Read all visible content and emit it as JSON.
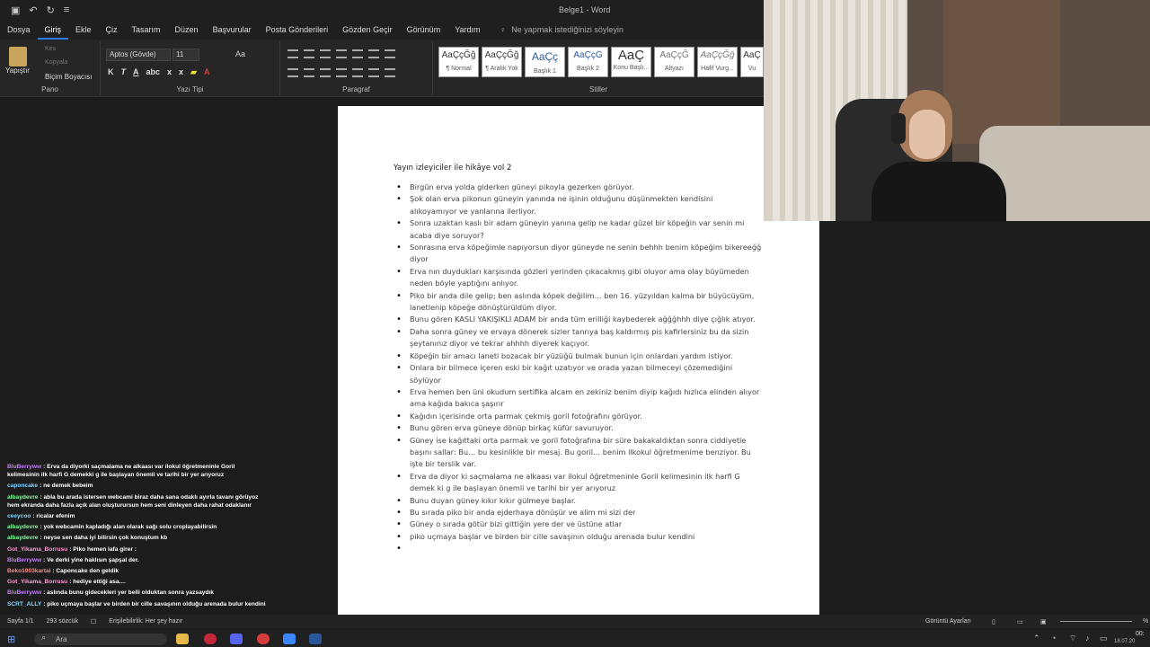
{
  "window": {
    "title": "Belge1 - Word"
  },
  "menu": {
    "items": [
      "Dosya",
      "Giriş",
      "Ekle",
      "Çiz",
      "Tasarım",
      "Düzen",
      "Başvurular",
      "Posta Gönderileri",
      "Gözden Geçir",
      "Görünüm",
      "Yardım"
    ],
    "active": "Giriş",
    "tellme": "Ne yapmak istediğinizi söyleyin"
  },
  "ribbon": {
    "pano": {
      "paste": "Yapıştır",
      "cut": "Kes",
      "copy": "Kopyala",
      "painter": "Biçim Boyacısı",
      "label": "Pano"
    },
    "font": {
      "name": "Aptos (Gövde)",
      "size": "11",
      "case": "Aa",
      "label": "Yazı Tipi",
      "buttons": [
        "K",
        "T",
        "A",
        "abc",
        "x",
        "x"
      ]
    },
    "paragraph": {
      "label": "Paragraf"
    },
    "styles": {
      "label": "Stiller",
      "cards": [
        {
          "sample": "AaÇçĞğ",
          "name": "¶ Normal"
        },
        {
          "sample": "AaÇçĞğ",
          "name": "¶ Aralık Yok"
        },
        {
          "sample": "AaÇç",
          "name": "Başlık 1"
        },
        {
          "sample": "AaÇçG",
          "name": "Başlık 2"
        },
        {
          "sample": "AaÇ",
          "name": "Konu Başlı..."
        },
        {
          "sample": "AaÇçĞ",
          "name": "Altyazı"
        },
        {
          "sample": "AaÇçĞğ",
          "name": "Hafif Vurg..."
        },
        {
          "sample": "AaÇ",
          "name": "Vu"
        }
      ]
    }
  },
  "document": {
    "heading": "Yayın izleyiciler ile hikâye vol 2",
    "bullets": [
      "Birgün erva yolda giderken güneyi pikoyla gezerken görüyor.",
      "Şok olan erva pikonun güneyin yanında ne işinin olduğunu düşünmekten kendisini alıkoyamıyor ve yanlarına ilerliyor.",
      " Sonra uzaktan kaslı bir adam güneyin yanına gelip ne kadar güzel bir köpeğin var senin mi acaba diye soruyor?",
      "Sonrasına erva köpeğimle napıyorsun diyor güneyde ne senin behhh benim köpeğim bikereeğğ diyor",
      "Erva nın duydukları karşısında gözleri yerinden çıkacakmış gibi oluyor ama olay büyümeden neden böyle yaptığını anlıyor.",
      "Piko bir anda dile gelip; ben aslında köpek değilim… ben 16. yüzyıldan kalma bir büyücüyüm, lanetlenip köpeğe dönüştürüldüm diyor.",
      "Bunu gören KASLI YAKIŞIKLI ADAM bir anda tüm erilliği kaybederek ağğğhhh diye çığlık atıyor.",
      "Daha sonra güney ve ervaya dönerek sizler tanrıya baş kaldırmış pis kafirlersiniz bu da sizin şeytanınız diyor ve tekrar ahhhh diyerek kaçıyor.",
      "Köpeğin bir amacı laneti bozacak bir yüzüğü bulmak bunun için onlardan yardım istiyor.",
      "Onlara bir bilmece içeren eski bir kağıt uzatıyor ve orada yazan bilmeceyi çözemediğini söylüyor",
      "Erva hemen ben üni okudum sertifika alcam en zekiniz benim diyip kağıdı hızlıca elinden alıyor ama kağıda bakıca şaşırır",
      "Kağıdın içerisinde orta parmak çekmiş goril fotoğrafını görüyor.",
      "Bunu gören erva güneye dönüp birkaç küfür savuruyor.",
      "Güney ise kağıttaki orta parmak ve goril fotoğrafına bir süre bakakaldıktan sonra ciddiyetle başını sallar: Bu… bu kesinlikle bir mesaj. Bu goril… benim ilkokul öğretmenime benziyor. Bu işte bir terslik var.",
      "Erva da diyor ki saçmalama ne alkaası var ilokul öğretmeninle Goril kelimesinin ilk harfi G demek ki g ile başlayan önemli ve tarihi bir yer arıyoruz",
      "Bunu duyan güney kıkır kıkır gülmeye başlar.",
      "Bu sırada piko bir anda ejderhaya dönüşür ve alim mi sizi der",
      "Güney o sırada götür bizi gittiğin yere der ve üstüne atlar",
      "piko uçmaya başlar ve birden bir cille savaşının olduğu arenada bulur kendini",
      ""
    ]
  },
  "chat": [
    {
      "user": "BluBerryww",
      "color": "#c77dff",
      "text": ": Erva da diyorki saçmalama ne alkaası var ilokul öğretmeninle Goril kelimesinin ilk harfi G demekki g ile başlayan önemli ve tarihi bir yer arıyoruz"
    },
    {
      "user": "caponcake",
      "color": "#7fd4ff",
      "text": ": ne demek bebeim"
    },
    {
      "user": "albaydevre",
      "color": "#7fff9c",
      "text": ": abla bu arada istersen webcami biraz daha sana odaklı ayırla tavanı görüyoz hem ekranda daha fazla açık alan oluşturursun hem seni dinleyen daha rahat odaklanır"
    },
    {
      "user": "ceeycoo",
      "color": "#7fd4ff",
      "text": ": ricalar efenim"
    },
    {
      "user": "albaydevre",
      "color": "#7fff9c",
      "text": ": yok webcamin kapladığı alan olarak sağı solu croplayabilirsin"
    },
    {
      "user": "albaydevre",
      "color": "#7fff9c",
      "text": ": neyse sen daha iyi bilirsin çok konuştum kb"
    },
    {
      "user": "Got_Yikama_Borrusu",
      "color": "#ff9ad5",
      "text": ": Piko hemen lafa girer :"
    },
    {
      "user": "BluBerryww",
      "color": "#c77dff",
      "text": ": Ve derki yine haklısın şapşal der."
    },
    {
      "user": "Beko1903kartal",
      "color": "#ff8a8a",
      "text": ": Caponcake den geldik"
    },
    {
      "user": "Got_Yikama_Borrusu",
      "color": "#ff9ad5",
      "text": ": hediye ettiği asa...."
    },
    {
      "user": "BluBerryww",
      "color": "#c77dff",
      "text": ": aslında bunu gidecekleri yer belli olduktan sonra yazsaydık"
    },
    {
      "user": "SCRT_ALLY",
      "color": "#7fd4ff",
      "text": ": piko uçmaya başlar ve birden bir cille savaşının olduğu arenada bulur kendini"
    }
  ],
  "status": {
    "page": "Sayfa 1/1",
    "words": "293 sözcük",
    "accessibility": "Erişilebilirlik: Her şey hazır",
    "focus": "Görüntü Ayarları",
    "zoom": "%"
  },
  "taskbar": {
    "search": "Ara",
    "time": "00:",
    "date": "18.07.20"
  }
}
